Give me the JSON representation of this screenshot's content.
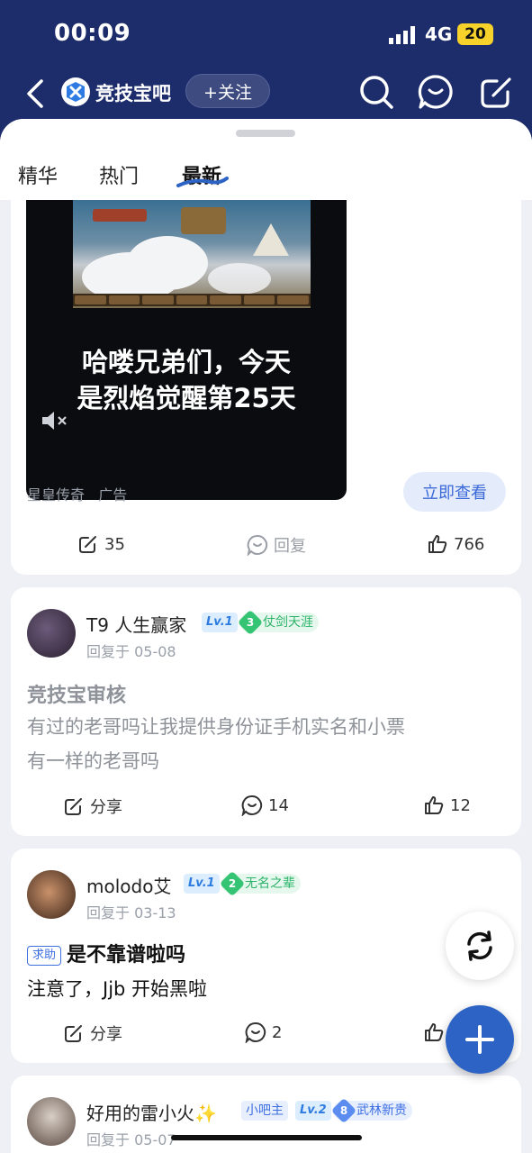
{
  "status_bar": {
    "time": "00:09",
    "network": "4G",
    "battery": "20"
  },
  "nav": {
    "forum_name": "竞技宝吧",
    "follow_label": "+关注"
  },
  "tabs": [
    {
      "label": "精华"
    },
    {
      "label": "热门"
    },
    {
      "label": "最新",
      "active": true
    }
  ],
  "ad": {
    "caption_line1": "哈喽兄弟们，今天",
    "caption_line2": "是烈焰觉醒第25天",
    "source": "星皇传奇",
    "ad_label": "广告",
    "cta": "立即查看",
    "share_count": "35",
    "reply_label": "回复",
    "like_count": "766"
  },
  "posts": [
    {
      "username": "T9 人生赢家",
      "level": "Lv.1",
      "title_level": "3",
      "title_name": "仗剑天涯",
      "time": "回复于 05-08",
      "title": "竞技宝审核",
      "body_line1": "有过的老哥吗让我提供身份证手机实名和小票",
      "body_line2": "有一样的老哥吗",
      "share_label": "分享",
      "comment_count": "14",
      "like_count": "12"
    },
    {
      "username": "molodo艾",
      "level": "Lv.1",
      "title_level": "2",
      "title_name": "无名之辈",
      "time": "回复于 03-13",
      "tag": "求助",
      "title": "是不靠谱啦吗",
      "body": "注意了，Jjb 开始黑啦",
      "share_label": "分享",
      "comment_count": "2"
    },
    {
      "username": "好用的雷小火✨",
      "mod_badge": "小吧主",
      "level": "Lv.2",
      "title_level": "8",
      "title_name": "武林新贵",
      "time": "回复于 05-07"
    }
  ],
  "colors": {
    "nav_bg": "#1d2c6b",
    "accent": "#2d63c4",
    "title_green": "#2bb36a"
  }
}
